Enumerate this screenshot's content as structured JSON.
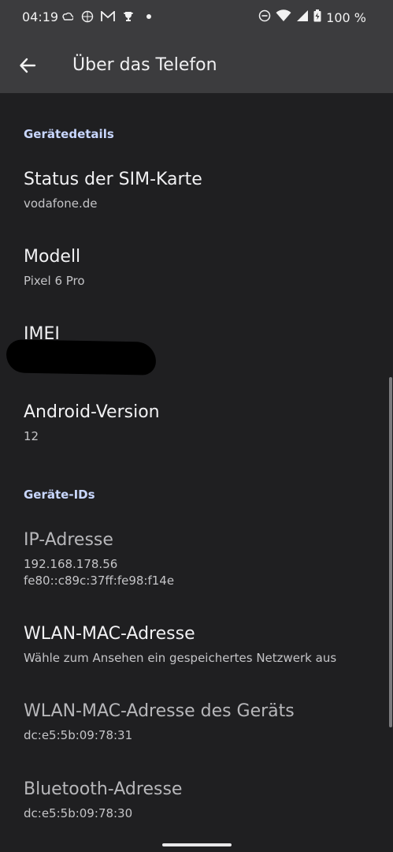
{
  "statusbar": {
    "time": "04:19",
    "icons": [
      "weather-icon",
      "vpn-icon",
      "gmail-icon",
      "trophy-icon",
      "dot-icon"
    ],
    "right_icons": [
      "dnd-icon",
      "wifi-icon",
      "signal-icon",
      "battery-icon"
    ],
    "battery": "100 %"
  },
  "appbar": {
    "title": "Über das Telefon"
  },
  "sections": {
    "device_details": "Gerätedetails",
    "device_ids": "Geräte-IDs"
  },
  "items": [
    {
      "title": "Status der SIM-Karte",
      "sub": "vodafone.de"
    },
    {
      "title": "Modell",
      "sub": "Pixel 6 Pro"
    },
    {
      "title": "IMEI",
      "sub": ""
    },
    {
      "title": "Android-Version",
      "sub": "12"
    },
    {
      "title": "IP-Adresse",
      "sub1": "192.168.178.56",
      "sub2": "fe80::c89c:37ff:fe98:f14e"
    },
    {
      "title": "WLAN-MAC-Adresse",
      "sub": "Wähle zum Ansehen ein gespeichertes Netzwerk aus"
    },
    {
      "title": "WLAN-MAC-Adresse des Geräts",
      "sub": "dc:e5:5b:09:78:31"
    },
    {
      "title": "Bluetooth-Adresse",
      "sub": "dc:e5:5b:09:78:30"
    }
  ]
}
